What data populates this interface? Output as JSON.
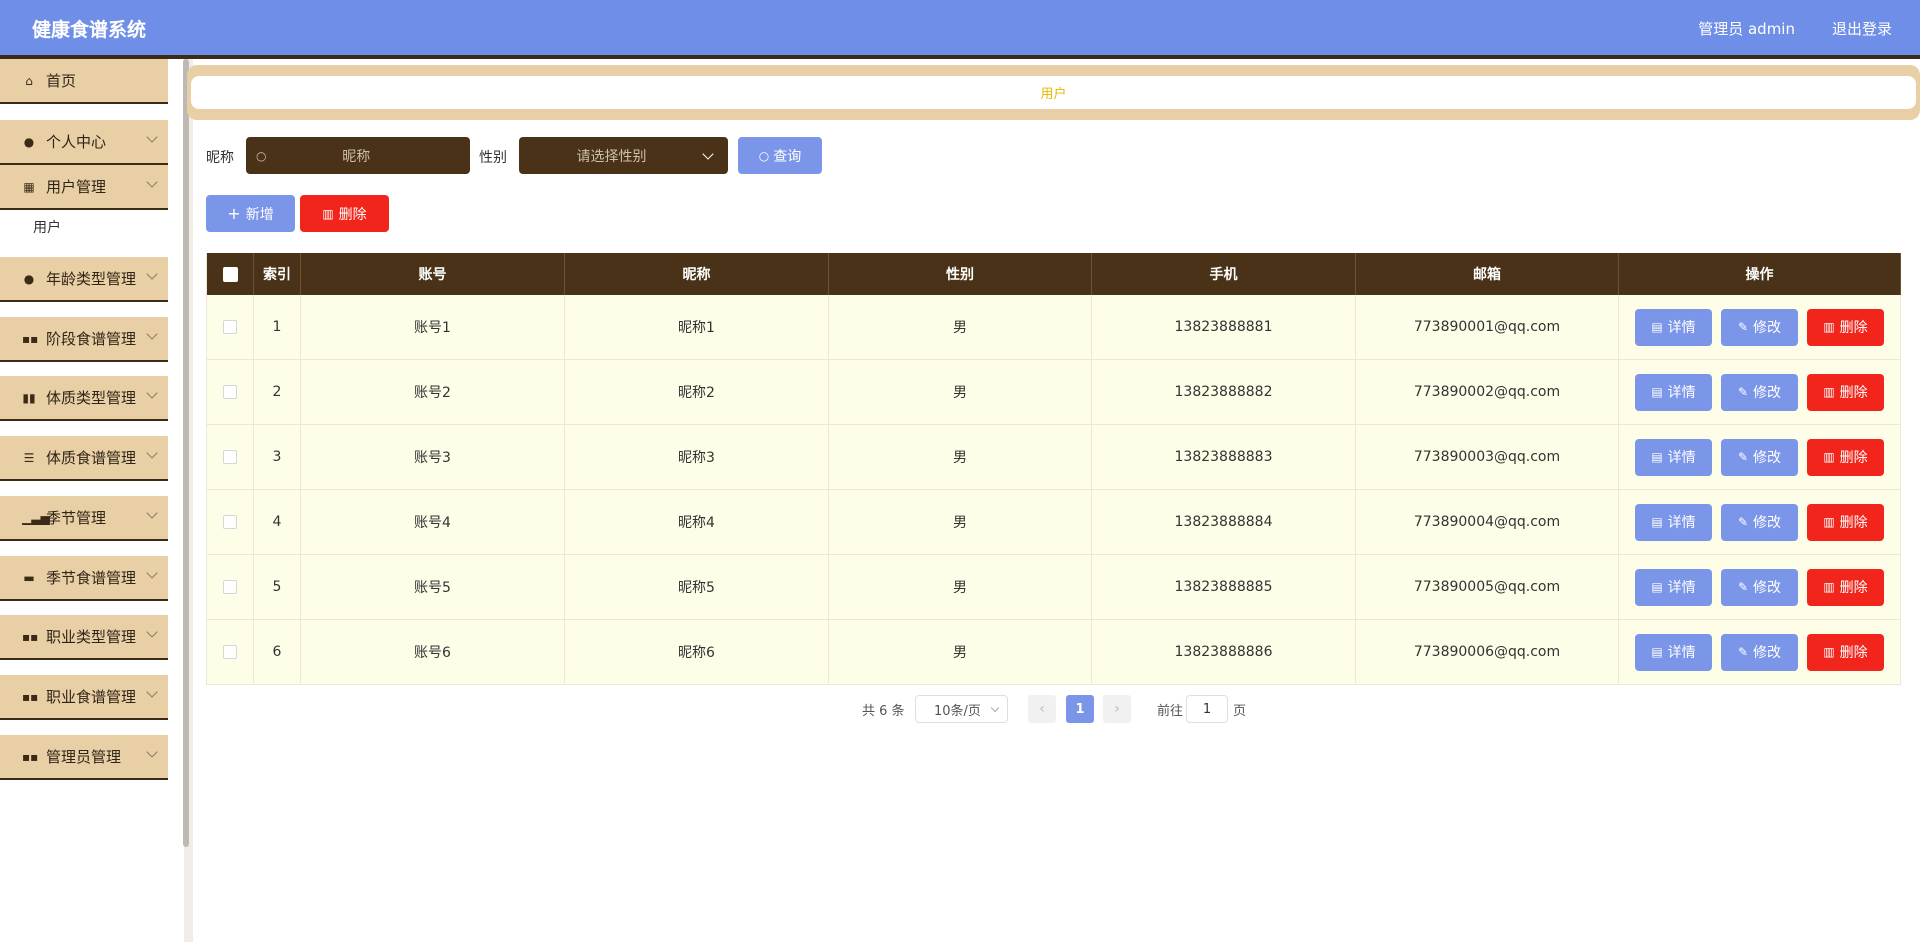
{
  "header": {
    "app_title": "健康食谱系统",
    "user_info": "管理员 admin",
    "logout": "退出登录"
  },
  "sidebar": {
    "items": [
      {
        "label": "首页",
        "icon": "home-icon",
        "has_children": false
      },
      {
        "label": "个人中心",
        "icon": "person-icon",
        "has_children": true
      },
      {
        "label": "用户管理",
        "icon": "grid-icon",
        "has_children": true
      },
      {
        "label": "年龄类型管理",
        "icon": "person-icon",
        "has_children": true
      },
      {
        "label": "阶段食谱管理",
        "icon": "apps-icon",
        "has_children": true
      },
      {
        "label": "体质类型管理",
        "icon": "books-icon",
        "has_children": true
      },
      {
        "label": "体质食谱管理",
        "icon": "list-icon",
        "has_children": true
      },
      {
        "label": "季节管理",
        "icon": "bar-chart-icon",
        "has_children": true
      },
      {
        "label": "季节食谱管理",
        "icon": "monitor-icon",
        "has_children": true
      },
      {
        "label": "职业类型管理",
        "icon": "apps-icon",
        "has_children": true
      },
      {
        "label": "职业食谱管理",
        "icon": "apps-icon",
        "has_children": true
      },
      {
        "label": "管理员管理",
        "icon": "apps-icon",
        "has_children": true
      }
    ],
    "sub_item": "用户"
  },
  "breadcrumb": "用户",
  "search": {
    "nickname_label": "昵称",
    "nickname_placeholder": "昵称",
    "gender_label": "性别",
    "gender_placeholder": "请选择性别",
    "query_button": "查询"
  },
  "actions": {
    "add_button": "新增",
    "delete_button": "删除"
  },
  "table": {
    "columns": [
      "索引",
      "账号",
      "昵称",
      "性别",
      "手机",
      "邮箱",
      "操作"
    ],
    "rows": [
      {
        "index": "1",
        "account": "账号1",
        "nickname": "昵称1",
        "gender": "男",
        "phone": "13823888881",
        "email": "773890001@qq.com"
      },
      {
        "index": "2",
        "account": "账号2",
        "nickname": "昵称2",
        "gender": "男",
        "phone": "13823888882",
        "email": "773890002@qq.com"
      },
      {
        "index": "3",
        "account": "账号3",
        "nickname": "昵称3",
        "gender": "男",
        "phone": "13823888883",
        "email": "773890003@qq.com"
      },
      {
        "index": "4",
        "account": "账号4",
        "nickname": "昵称4",
        "gender": "男",
        "phone": "13823888884",
        "email": "773890004@qq.com"
      },
      {
        "index": "5",
        "account": "账号5",
        "nickname": "昵称5",
        "gender": "男",
        "phone": "13823888885",
        "email": "773890005@qq.com"
      },
      {
        "index": "6",
        "account": "账号6",
        "nickname": "昵称6",
        "gender": "男",
        "phone": "13823888886",
        "email": "773890006@qq.com"
      }
    ],
    "row_actions": {
      "detail": "详情",
      "edit": "修改",
      "delete": "删除"
    }
  },
  "pagination": {
    "total": "共 6 条",
    "page_size": "10条/页",
    "current_page": "1",
    "goto_label": "前往",
    "goto_value": "1",
    "page_suffix": "页"
  },
  "colors": {
    "header_bg": "#6f8ee8",
    "sidebar_item_bg": "#e9cfa6",
    "dark_brown": "#4a3218",
    "primary_blue": "#7b96e8",
    "danger_red": "#f1251b",
    "row_bg": "#fefde8",
    "breadcrumb_text": "#e6b800"
  }
}
